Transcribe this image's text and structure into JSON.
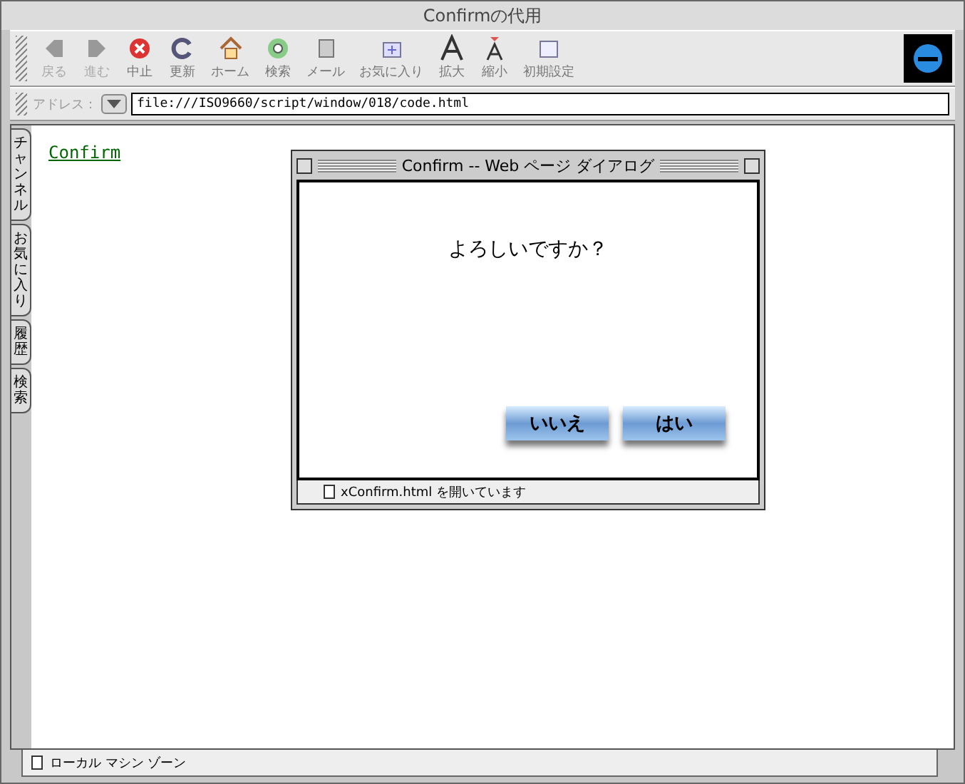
{
  "window": {
    "title": "Confirmの代用"
  },
  "toolbar": [
    {
      "label": "戻る",
      "kind": "back",
      "disabled": true
    },
    {
      "label": "進む",
      "kind": "forward",
      "disabled": true
    },
    {
      "label": "中止",
      "kind": "stop",
      "disabled": false
    },
    {
      "label": "更新",
      "kind": "refresh",
      "disabled": false
    },
    {
      "label": "ホーム",
      "kind": "home",
      "disabled": false
    },
    {
      "label": "検索",
      "kind": "search",
      "disabled": false
    },
    {
      "label": "メール",
      "kind": "mail",
      "disabled": false
    },
    {
      "label": "お気に入り",
      "kind": "favorites",
      "disabled": false
    },
    {
      "label": "拡大",
      "kind": "larger",
      "disabled": false
    },
    {
      "label": "縮小",
      "kind": "smaller",
      "disabled": false
    },
    {
      "label": "初期設定",
      "kind": "prefs",
      "disabled": false
    }
  ],
  "address": {
    "label": "アドレス：",
    "value": "file:///ISO9660/script/window/018/code.html"
  },
  "side_tabs": [
    {
      "label": "チャンネル"
    },
    {
      "label": "お気に入り"
    },
    {
      "label": "履歴"
    },
    {
      "label": "検索"
    }
  ],
  "page": {
    "link": "Confirm"
  },
  "dialog": {
    "title": "Confirm -- Web ページ ダイアログ",
    "message": "よろしいですか？",
    "buttons": [
      "いいえ",
      "はい"
    ],
    "status": "xConfirm.html を開いています"
  },
  "status_bar": {
    "text": "ローカル マシン ゾーン"
  }
}
